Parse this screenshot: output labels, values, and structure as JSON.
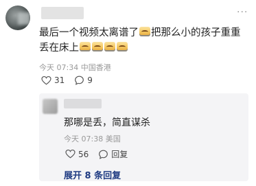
{
  "post": {
    "text_part1": "最后一个视频太离谱了",
    "text_part2": "把那么小的孩子重重丢在床上",
    "time": "今天 07:34",
    "location": "中国香港",
    "likes": "31",
    "comments": "9",
    "more": "···"
  },
  "reply": {
    "text": "那哪是丢，简直谋杀",
    "time": "今天 07:38",
    "location": "美国",
    "likes": "56",
    "reply_label": "回复",
    "expand_label": "展开 8 条回复"
  },
  "icons": {
    "emoji": "crying-laughing-emoji",
    "like": "heart-icon",
    "comment": "comment-bubble-icon",
    "more": "more-dots-icon"
  }
}
